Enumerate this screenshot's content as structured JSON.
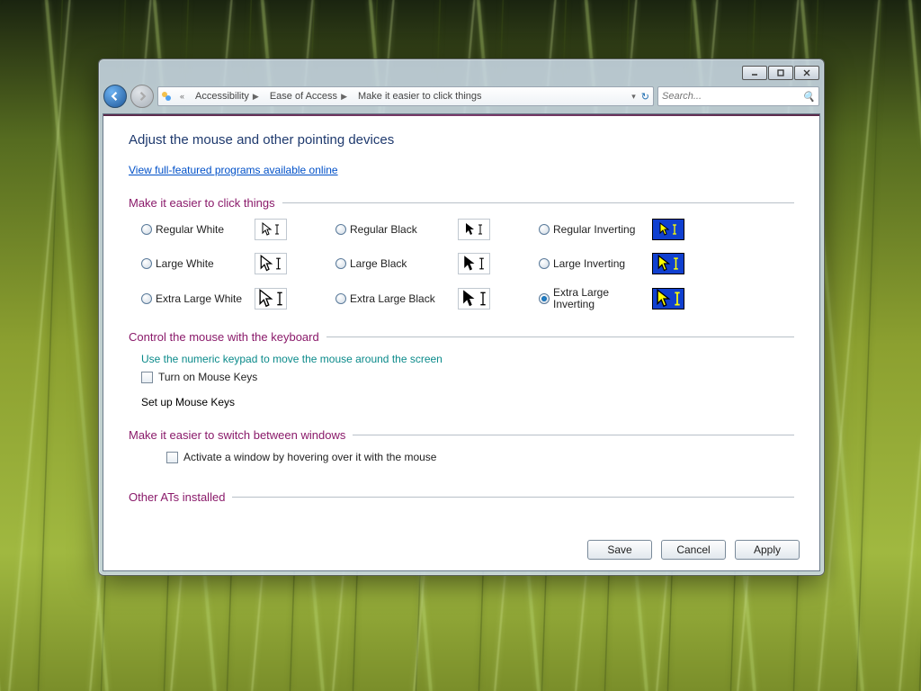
{
  "breadcrumb": {
    "seg1": "Accessibility",
    "seg2": "Ease of Access",
    "seg3": "Make it easier to click things"
  },
  "search": {
    "placeholder": "Search..."
  },
  "page": {
    "title": "Adjust the mouse and other pointing devices",
    "link_online": "View full-featured programs available online"
  },
  "sections": {
    "pointers_head": "Make it easier to click things",
    "keyboard_head": "Control the mouse with the keyboard",
    "switch_head": "Make it easier to switch between windows",
    "other_head": "Other ATs installed"
  },
  "pointers": {
    "r1c1": "Regular White",
    "r1c2": "Regular Black",
    "r1c3": "Regular Inverting",
    "r2c1": "Large White",
    "r2c2": "Large Black",
    "r2c3": "Large Inverting",
    "r3c1": "Extra Large White",
    "r3c2": "Extra Large Black",
    "r3c3": "Extra Large Inverting"
  },
  "keyboard": {
    "desc": "Use the numeric keypad to move the mouse around the screen",
    "checkbox": "Turn on Mouse Keys",
    "setup": "Set up Mouse Keys"
  },
  "switch": {
    "checkbox": "Activate a window by hovering over it with the mouse"
  },
  "buttons": {
    "save": "Save",
    "cancel": "Cancel",
    "apply": "Apply"
  }
}
